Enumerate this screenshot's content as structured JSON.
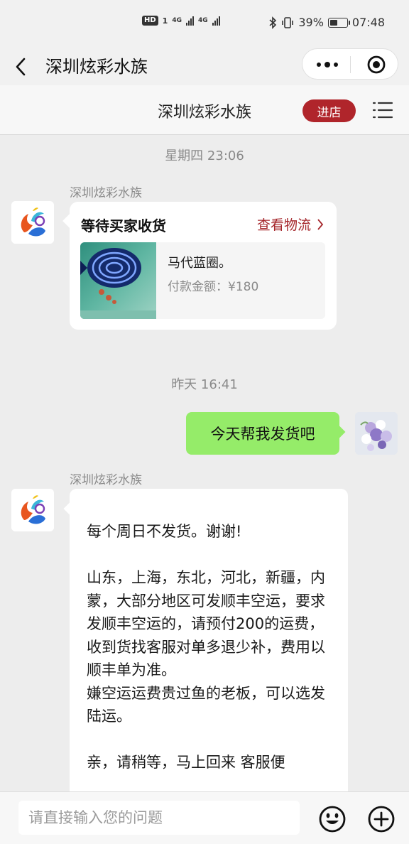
{
  "status_bar": {
    "hd": "HD",
    "sim1": "1",
    "net1": "4G",
    "net2": "4G",
    "battery_percent": "39%",
    "battery_level": 0.39,
    "time": "07:48"
  },
  "navbar": {
    "title": "深圳炫彩水族",
    "back_icon": "chevron-left-icon",
    "more_icon": "more-dots-icon",
    "close_icon": "target-circle-icon"
  },
  "shop_header": {
    "name": "深圳炫彩水族",
    "enter_label": "进店",
    "menu_icon": "list-icon",
    "accent_color": "#b0252b"
  },
  "chat": {
    "messages": [
      {
        "type": "time",
        "text": "星期四 23:06"
      },
      {
        "type": "order_card",
        "sender": "深圳炫彩水族",
        "status": "等待买家收货",
        "logistics_link": "查看物流",
        "product_name": "马代蓝圈。",
        "price_text": "付款金额：¥180"
      },
      {
        "type": "time",
        "text": "昨天 16:41"
      },
      {
        "type": "outgoing",
        "text": "今天帮我发货吧",
        "bubble_color": "#95ec69"
      },
      {
        "type": "incoming",
        "sender": "深圳炫彩水族",
        "text": "每个周日不发货。谢谢!\n\n山东，上海，东北，河北，新疆，内蒙，大部分地区可发顺丰空运，要求发顺丰空运的，请预付200的运费，收到货找客服对单多退少补，费用以顺丰单为准。\n嫌空运运费贵过鱼的老板，可以选发陆运。\n\n亲，请稍等，马上回来 客服便"
      }
    ]
  },
  "input_bar": {
    "placeholder": "请直接输入您的问题",
    "emoji_icon": "emoji-icon",
    "plus_icon": "plus-circle-icon"
  }
}
